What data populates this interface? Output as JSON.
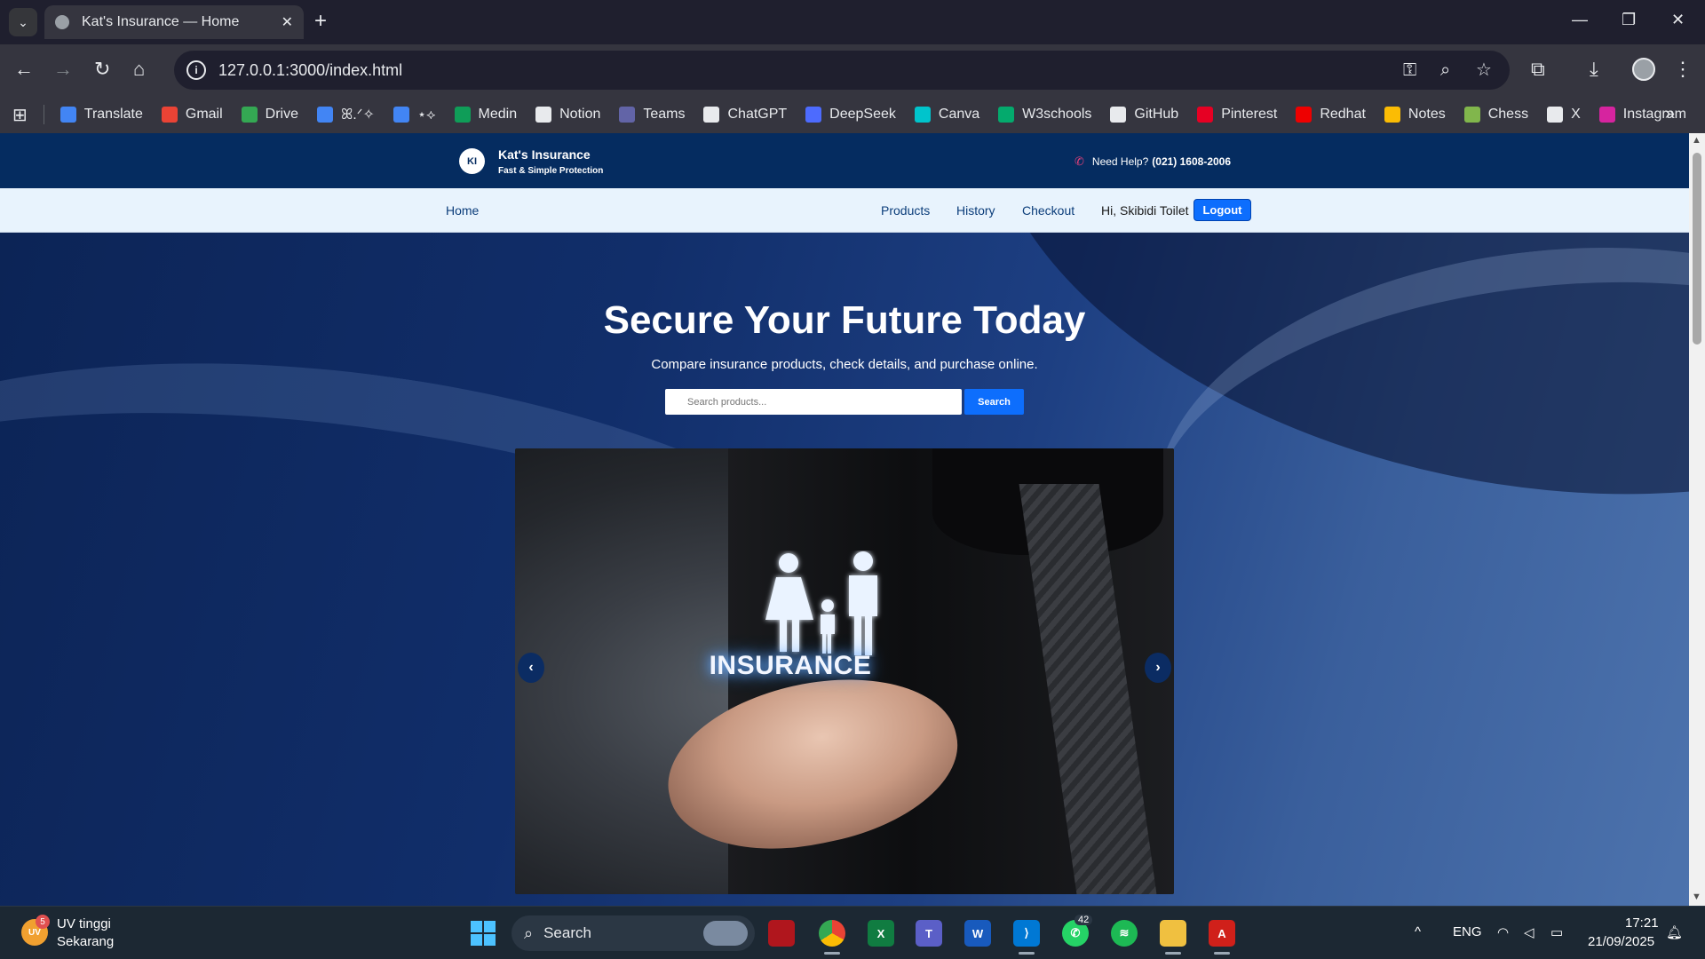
{
  "browser": {
    "tab_title": "Kat's Insurance — Home",
    "url": "127.0.0.1:3000/index.html",
    "bookmarks": [
      {
        "label": "Translate",
        "color": "#4285f4"
      },
      {
        "label": "Gmail",
        "color": "#ea4335"
      },
      {
        "label": "Drive",
        "color": "#34a853"
      },
      {
        "label": "ꕤ.ᐟ✧",
        "color": "#4285f4"
      },
      {
        "label": "⋆⟡",
        "color": "#4285f4"
      },
      {
        "label": "Medin",
        "color": "#0f9d58"
      },
      {
        "label": "Notion",
        "color": "#e8eaed"
      },
      {
        "label": "Teams",
        "color": "#6264a7"
      },
      {
        "label": "ChatGPT",
        "color": "#e8eaed"
      },
      {
        "label": "DeepSeek",
        "color": "#4d6bfe"
      },
      {
        "label": "Canva",
        "color": "#00c4cc"
      },
      {
        "label": "W3schools",
        "color": "#04aa6d"
      },
      {
        "label": "GitHub",
        "color": "#e8eaed"
      },
      {
        "label": "Pinterest",
        "color": "#e60023"
      },
      {
        "label": "Redhat",
        "color": "#ee0000"
      },
      {
        "label": "Notes",
        "color": "#fbbc04"
      },
      {
        "label": "Chess",
        "color": "#81b64c"
      },
      {
        "label": "X",
        "color": "#e8eaed"
      },
      {
        "label": "Instagram",
        "color": "#d6249f"
      }
    ]
  },
  "site": {
    "logo_initials": "KI",
    "brand_name": "Kat's Insurance",
    "brand_tagline": "Fast & Simple Protection",
    "help_label": "Need Help?",
    "help_phone": "(021) 1608-2006",
    "nav": {
      "home": "Home",
      "products": "Products",
      "history": "History",
      "checkout": "Checkout",
      "greeting": "Hi, Skibidi Toilet",
      "logout": "Logout"
    },
    "hero": {
      "title": "Secure Your Future Today",
      "subtitle": "Compare insurance products, check details, and purchase online.",
      "search_placeholder": "Search products...",
      "search_button": "Search"
    },
    "carousel": {
      "image_text": "INSURANCE",
      "prev": "‹",
      "next": "›"
    }
  },
  "taskbar": {
    "weather_title": "UV tinggi",
    "weather_sub": "Sekarang",
    "weather_badge": "5",
    "weather_icon_text": "UV",
    "search_label": "Search",
    "whatsapp_badge": "42",
    "language": "ENG",
    "time": "17:21",
    "date": "21/09/2025"
  },
  "colors": {
    "header_bg": "#052c60",
    "nav_bg": "#e8f3fd",
    "accent": "#0d6efd"
  }
}
